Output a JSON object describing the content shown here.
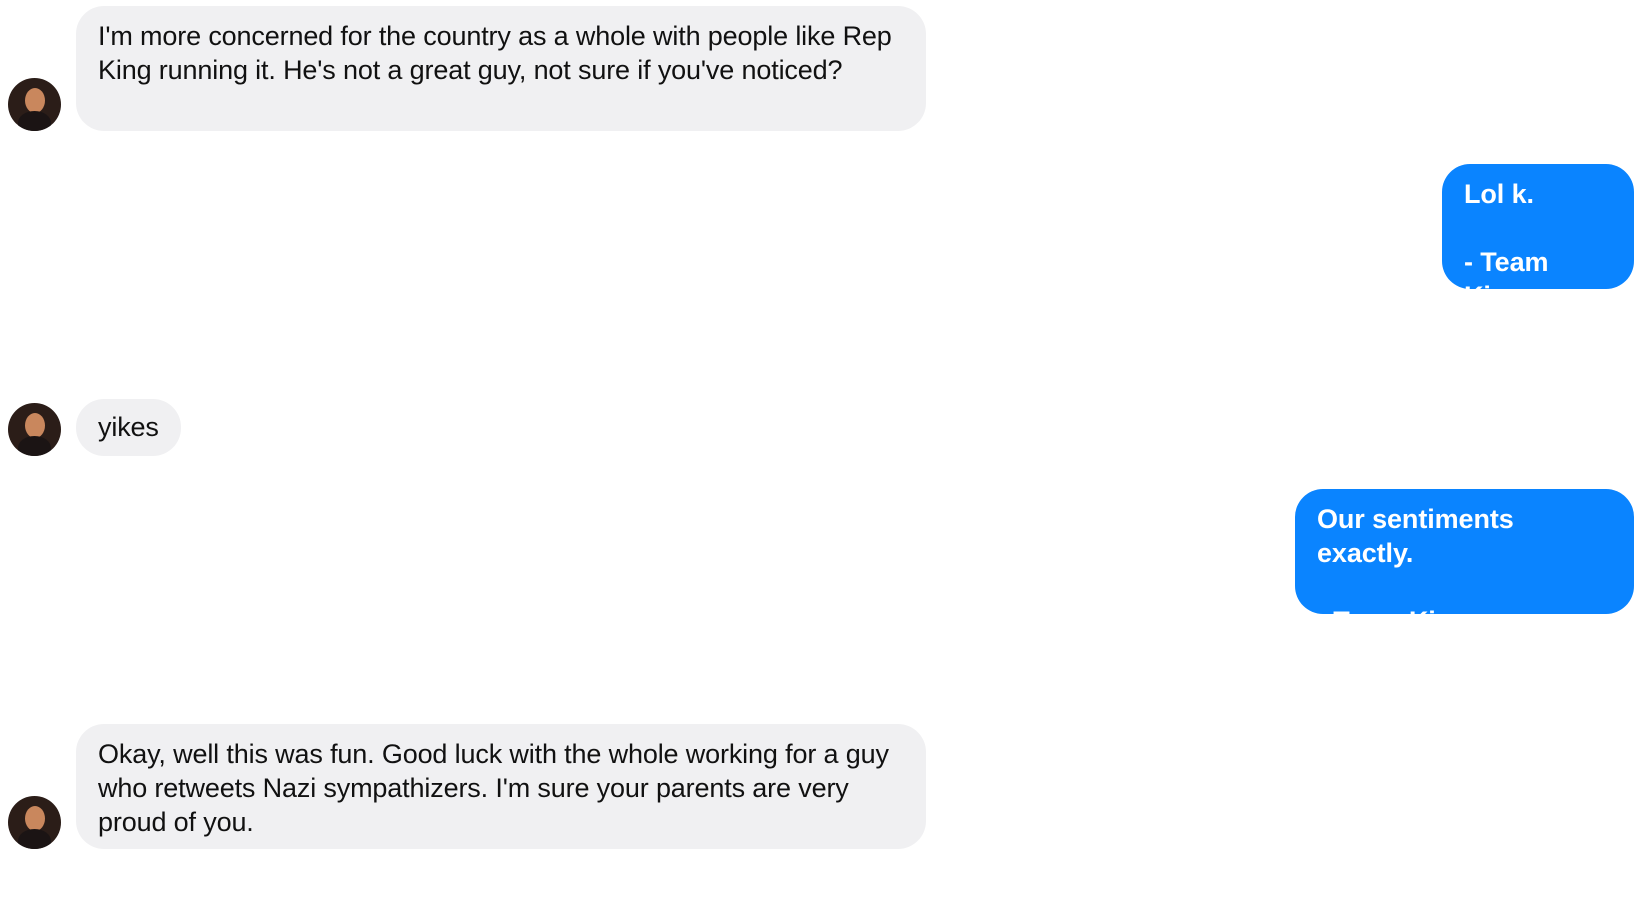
{
  "messages": [
    {
      "direction": "incoming",
      "avatar_icon": "user-avatar",
      "text": "I'm more concerned for the country as a whole with people like Rep King running it. He's not a great guy, not sure if you've noticed?"
    },
    {
      "direction": "outgoing",
      "text": "Lol k.\n\n- Team King"
    },
    {
      "direction": "incoming",
      "avatar_icon": "user-avatar",
      "text": "yikes"
    },
    {
      "direction": "outgoing",
      "text": "Our sentiments exactly.\n\n- Team King"
    },
    {
      "direction": "incoming",
      "avatar_icon": "user-avatar",
      "text": "Okay, well this was fun. Good luck with the whole working for a guy who retweets Nazi sympathizers. I'm sure your parents are very proud of you."
    }
  ],
  "colors": {
    "incoming_bubble": "#f0f0f2",
    "outgoing_bubble": "#0a84ff",
    "incoming_text": "#111111",
    "outgoing_text": "#ffffff"
  }
}
